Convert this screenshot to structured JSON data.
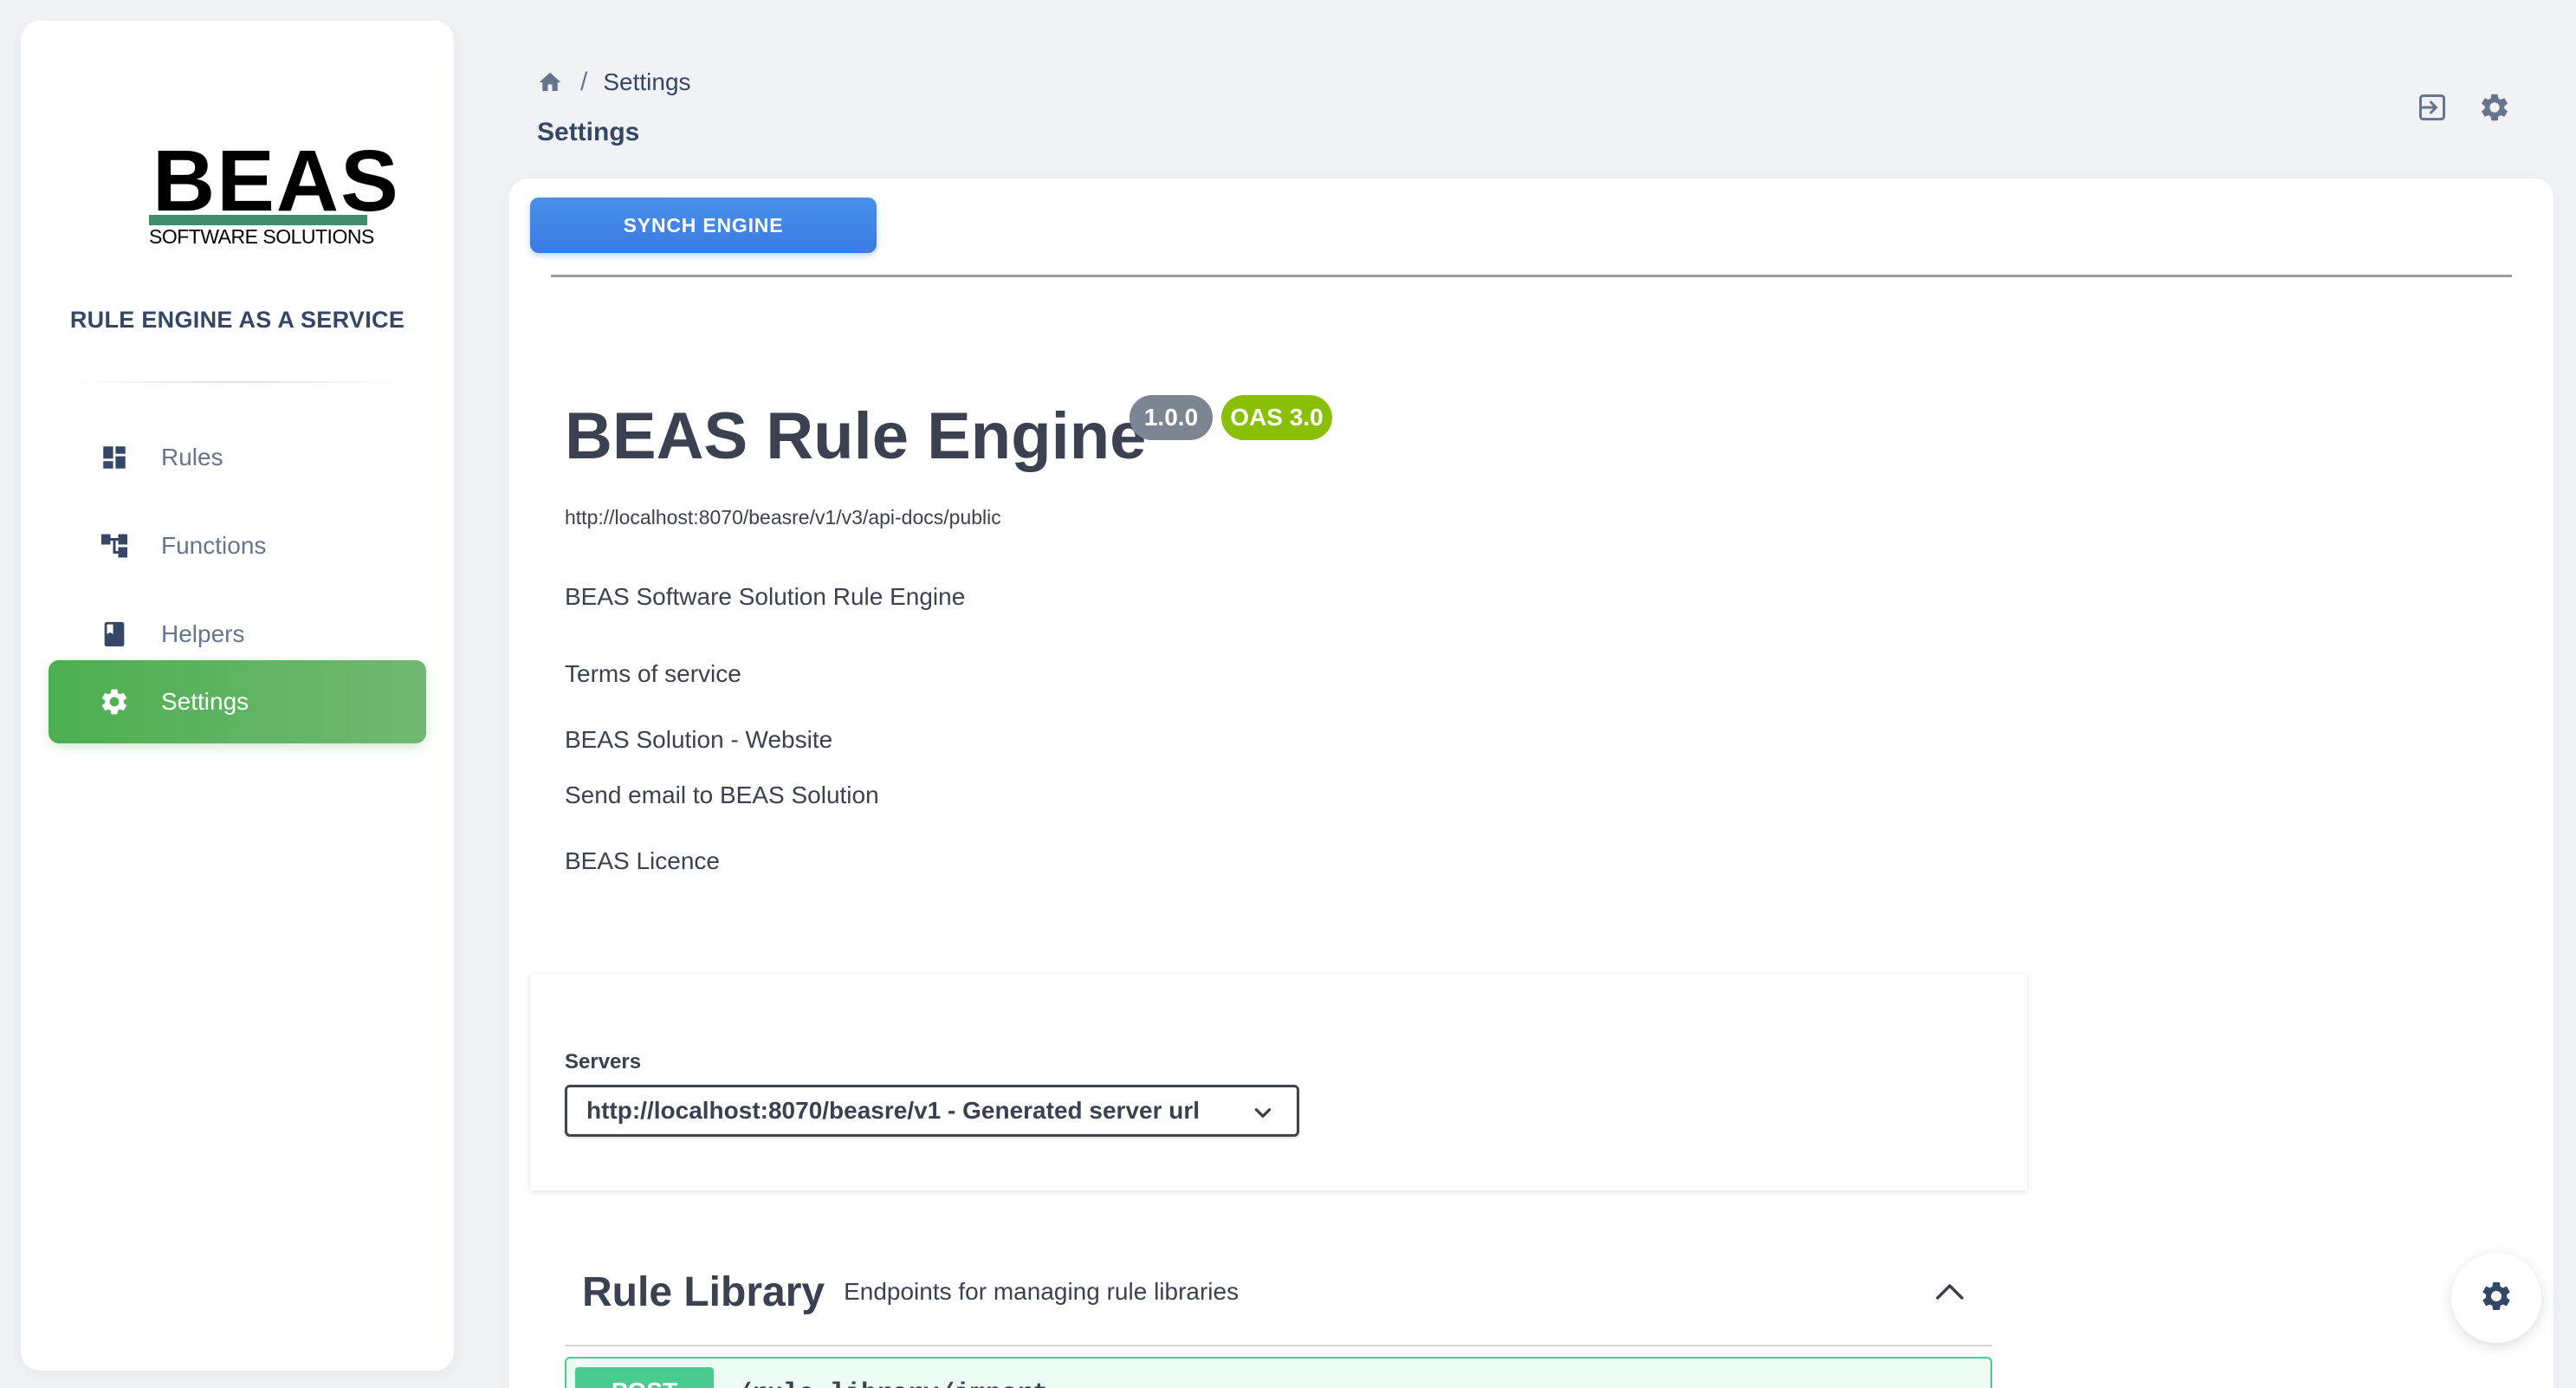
{
  "brand": {
    "logo_word": "BEAS",
    "logo_sub": "SOFTWARE SOLUTIONS",
    "tagline": "RULE ENGINE AS A SERVICE"
  },
  "sidebar": {
    "items": [
      {
        "label": "Rules",
        "icon": "dashboard-icon",
        "active": false
      },
      {
        "label": "Functions",
        "icon": "hierarchy-icon",
        "active": false
      },
      {
        "label": "Helpers",
        "icon": "book-icon",
        "active": false
      },
      {
        "label": "Settings",
        "icon": "gear-icon",
        "active": true
      }
    ]
  },
  "header": {
    "breadcrumb_sep": "/",
    "breadcrumb_current": "Settings",
    "title": "Settings",
    "icons": [
      "sign-in-icon",
      "gear-icon"
    ]
  },
  "main": {
    "synch_button": "SYNCH ENGINE",
    "api": {
      "title": "BEAS Rule Engine",
      "version": "1.0.0",
      "oas": "OAS 3.0",
      "url": "http://localhost:8070/beasre/v1/v3/api-docs/public",
      "description": "BEAS Software Solution Rule Engine",
      "links": [
        "Terms of service",
        "BEAS Solution - Website",
        "Send email to BEAS Solution",
        "BEAS Licence"
      ]
    },
    "servers": {
      "label": "Servers",
      "selected": "http://localhost:8070/beasre/v1 - Generated server url"
    },
    "tag": {
      "title": "Rule Library",
      "description": "Endpoints for managing rule libraries"
    },
    "operation": {
      "method": "POST",
      "path": "/rule-library/import"
    }
  },
  "colors": {
    "accent_green": "#4caf50",
    "button_blue": "#3b7ce0",
    "oas_badge": "#89bf04",
    "version_badge": "#7d8492",
    "post_green": "#49cc90"
  }
}
